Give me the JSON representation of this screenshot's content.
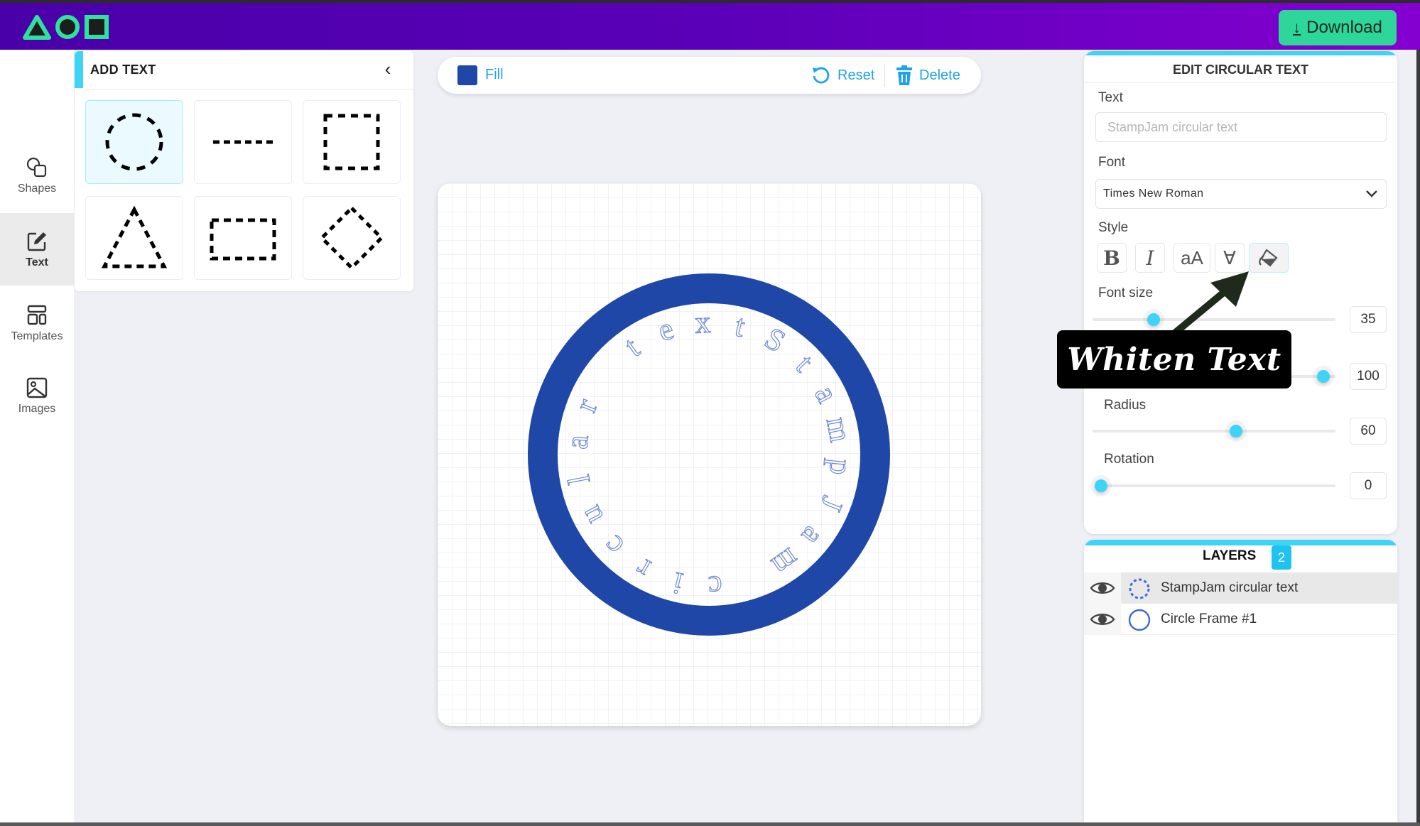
{
  "header": {
    "logo_icons": [
      "triangle-icon",
      "circle-icon",
      "square-icon"
    ],
    "download_label": "Download",
    "download_icon": "download-arrow-icon"
  },
  "colors": {
    "header_start": "#4a00a8",
    "header_end": "#8400d0",
    "accent_cyan": "#3ed4f7",
    "download_green": "#2ed69a",
    "logo_green": "#2fe0a0",
    "stamp_blue": "#1f47a8",
    "link_blue": "#1fa3e8"
  },
  "sidebar": {
    "items": [
      {
        "label": "Shapes",
        "icon": "shapes-icon",
        "active": false
      },
      {
        "label": "Text",
        "icon": "edit-text-icon",
        "active": true
      },
      {
        "label": "Templates",
        "icon": "templates-icon",
        "active": false
      },
      {
        "label": "Images",
        "icon": "image-icon",
        "active": false
      }
    ]
  },
  "add_text_panel": {
    "title": "ADD TEXT",
    "collapse_icon": "chevron-left-icon",
    "shapes": [
      {
        "name": "circle",
        "selected": true
      },
      {
        "name": "line",
        "selected": false
      },
      {
        "name": "square",
        "selected": false
      },
      {
        "name": "triangle",
        "selected": false
      },
      {
        "name": "rectangle",
        "selected": false
      },
      {
        "name": "diamond",
        "selected": false
      }
    ]
  },
  "toolbar": {
    "fill_label": "Fill",
    "fill_color": "#1f47a8",
    "reset_label": "Reset",
    "delete_label": "Delete"
  },
  "canvas": {
    "circular_text": "StampJam circular text",
    "frame_color": "#1f47a8",
    "text_outline_color": "#6f8ad6"
  },
  "edit_panel": {
    "title": "EDIT CIRCULAR TEXT",
    "text_label": "Text",
    "text_placeholder": "StampJam circular text",
    "font_label": "Font",
    "font_value": "Times New Roman",
    "style_label": "Style",
    "style_buttons": [
      {
        "name": "bold",
        "glyph": "B",
        "active": false
      },
      {
        "name": "italic",
        "glyph": "I",
        "active": false
      },
      {
        "name": "case",
        "glyph": "aA",
        "active": false
      },
      {
        "name": "flip",
        "glyph": "∀",
        "active": false
      },
      {
        "name": "fill-color",
        "glyph": "",
        "active": true
      }
    ],
    "sliders": [
      {
        "label": "Font size",
        "value": "35",
        "fraction": 0.25
      },
      {
        "label": "",
        "value": "100",
        "fraction": 0.95
      },
      {
        "label": "Radius",
        "value": "60",
        "fraction": 0.59
      },
      {
        "label": "Rotation",
        "value": "0",
        "fraction": 0.0
      }
    ]
  },
  "annotation": {
    "text": "Whiten Text"
  },
  "layers": {
    "title": "LAYERS",
    "count": "2",
    "items": [
      {
        "name": "StampJam circular text",
        "type": "dashed-circle",
        "selected": true
      },
      {
        "name": "Circle Frame #1",
        "type": "circle",
        "selected": false
      }
    ]
  }
}
